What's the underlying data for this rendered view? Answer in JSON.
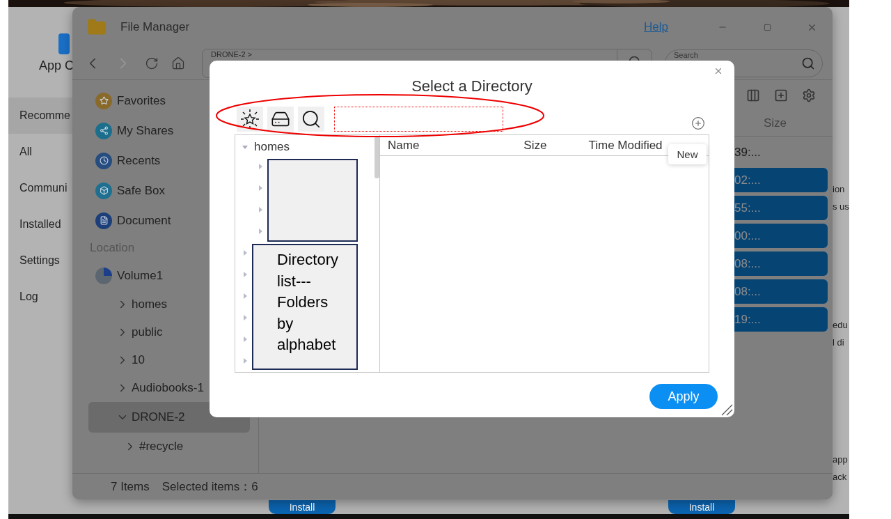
{
  "app_center": {
    "title": "App C",
    "sidebar": [
      {
        "label": "Recomme",
        "selected": true
      },
      {
        "label": "All",
        "selected": false
      },
      {
        "label": "Communi",
        "selected": false
      },
      {
        "label": "Installed",
        "selected": false
      },
      {
        "label": "Settings",
        "selected": false
      },
      {
        "label": "Log",
        "selected": false
      }
    ],
    "text_fragments": [
      "ion",
      "s us",
      "edu",
      "l di",
      "app",
      "ack"
    ],
    "install_buttons": [
      "Install",
      "Install"
    ]
  },
  "window": {
    "title": "File Manager",
    "help": "Help",
    "path": "DRONE-2 >",
    "search_placeholder": "Search",
    "sidebar": {
      "shortcuts": [
        "Favorites",
        "My Shares",
        "Recents",
        "Safe Box",
        "Document"
      ],
      "location_heading": "Location",
      "volume": "Volume1",
      "folders": [
        {
          "label": "homes",
          "expanded": false,
          "selected": false
        },
        {
          "label": "public",
          "expanded": false,
          "selected": false
        },
        {
          "label": "10",
          "expanded": false,
          "selected": false
        },
        {
          "label": "Audiobooks-1",
          "expanded": false,
          "selected": false
        },
        {
          "label": "DRONE-2",
          "expanded": true,
          "selected": true,
          "children": [
            {
              "label": "#recycle",
              "expanded": false,
              "selected": false
            }
          ]
        }
      ]
    },
    "table": {
      "column": "Size",
      "rows": [
        {
          "time": "39:...",
          "selected": false
        },
        {
          "time": "02:...",
          "selected": true
        },
        {
          "time": "55:...",
          "selected": true
        },
        {
          "time": "00:...",
          "selected": true
        },
        {
          "time": "08:...",
          "selected": true
        },
        {
          "time": "08:...",
          "selected": true
        },
        {
          "time": "19:...",
          "selected": true
        }
      ]
    },
    "status_bar": {
      "items": "7 Items",
      "selected_label": "Selected items：",
      "selected_count": "6"
    }
  },
  "dialog": {
    "title": "Select a Directory",
    "tooltip": "New",
    "tree": [
      {
        "label": "homes",
        "expanded": true,
        "children": [
          {
            "expanded": false
          },
          {
            "expanded": false
          },
          {
            "expanded": false
          },
          {
            "expanded": false
          }
        ]
      },
      {
        "expanded": false
      },
      {
        "expanded": false
      },
      {
        "expanded": false
      },
      {
        "expanded": false
      },
      {
        "expanded": false
      },
      {
        "expanded": false
      }
    ],
    "columns": [
      "Name",
      "Size",
      "Time Modified"
    ],
    "apply": "Apply"
  },
  "annotations": [
    {
      "kind": "ellipse"
    },
    {
      "kind": "box"
    },
    {
      "kind": "box",
      "text": "Directory\nlist---\nFolders\nby\nalphabet"
    }
  ]
}
